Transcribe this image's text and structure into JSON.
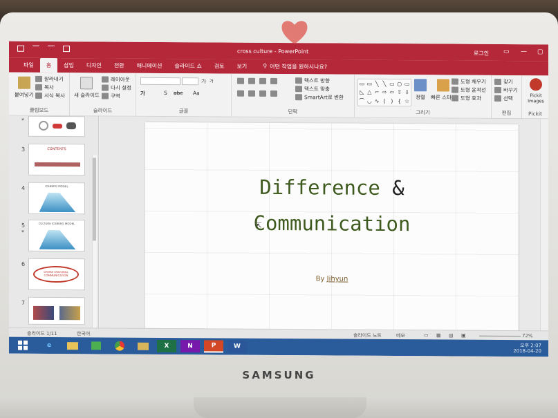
{
  "device": {
    "brand": "SAMSUNG"
  },
  "window": {
    "title": "cross culture  -  PowerPoint",
    "login": "로그인",
    "share": "공유"
  },
  "tabs": [
    "파일",
    "홈",
    "삽입",
    "디자인",
    "전환",
    "애니메이션",
    "슬라이드 쇼",
    "검토",
    "보기"
  ],
  "active_tab": "홈",
  "tell_me": "어떤 작업을 원하시나요?",
  "ribbon": {
    "clipboard": {
      "label": "클립보드",
      "paste": "붙여넣기",
      "cut": "잘라내기",
      "copy": "복사",
      "format_painter": "서식 복사"
    },
    "slides": {
      "label": "슬라이드",
      "new_slide": "새 슬라이드",
      "layout": "레이아웃",
      "reset": "다시 설정",
      "section": "구역"
    },
    "font": {
      "label": "글꼴",
      "bold": "가",
      "strike": "abc",
      "shadow": "S",
      "size_up": "가",
      "size_down": "가",
      "change_case": "Aa"
    },
    "paragraph": {
      "label": "단락",
      "text_direction": "텍스트 방향",
      "align_text": "텍스트 맞춤",
      "smartart": "SmartArt로 변환"
    },
    "drawing": {
      "label": "그리기",
      "arrange": "정렬",
      "quick_styles": "빠른 스타일",
      "fill": "도형 채우기",
      "outline": "도형 윤곽선",
      "effects": "도형 효과"
    },
    "editing": {
      "label": "편집",
      "find": "찾기",
      "replace": "바꾸기",
      "select": "선택"
    },
    "pickit": {
      "label": "Pickit",
      "button": "Pickit Images"
    }
  },
  "thumbnails": [
    {
      "num": "",
      "star": "*"
    },
    {
      "num": "3",
      "star": "",
      "heading": "CONTENTS"
    },
    {
      "num": "4",
      "star": "",
      "heading": "ICEBERG MODEL"
    },
    {
      "num": "5",
      "star": "*",
      "heading": "CULTURE ICEBERG MODEL"
    },
    {
      "num": "6",
      "star": "",
      "heading": "CROSS CULTURAL COMMUNICATION"
    },
    {
      "num": "7",
      "star": "",
      "heading": ""
    }
  ],
  "slide": {
    "line1": "Difference ",
    "amp": "&",
    "line2": "Communication",
    "by": "By",
    "author": "Jihyun"
  },
  "status": {
    "slide_count": "슬라이드 1/11",
    "language": "한국어",
    "notes": "슬라이드 노트",
    "comments": "메모",
    "zoom": "72%"
  },
  "taskbar": {
    "apps": [
      "windows-start",
      "internet-explorer",
      "file-explorer",
      "store",
      "chrome",
      "folder",
      "excel",
      "onenote",
      "powerpoint",
      "word"
    ],
    "time": "오후 2:07",
    "date": "2018-04-20"
  },
  "colors": {
    "accent": "#b5283a",
    "title_green": "#3f5a1e",
    "taskbar": "#2a5b9a"
  }
}
